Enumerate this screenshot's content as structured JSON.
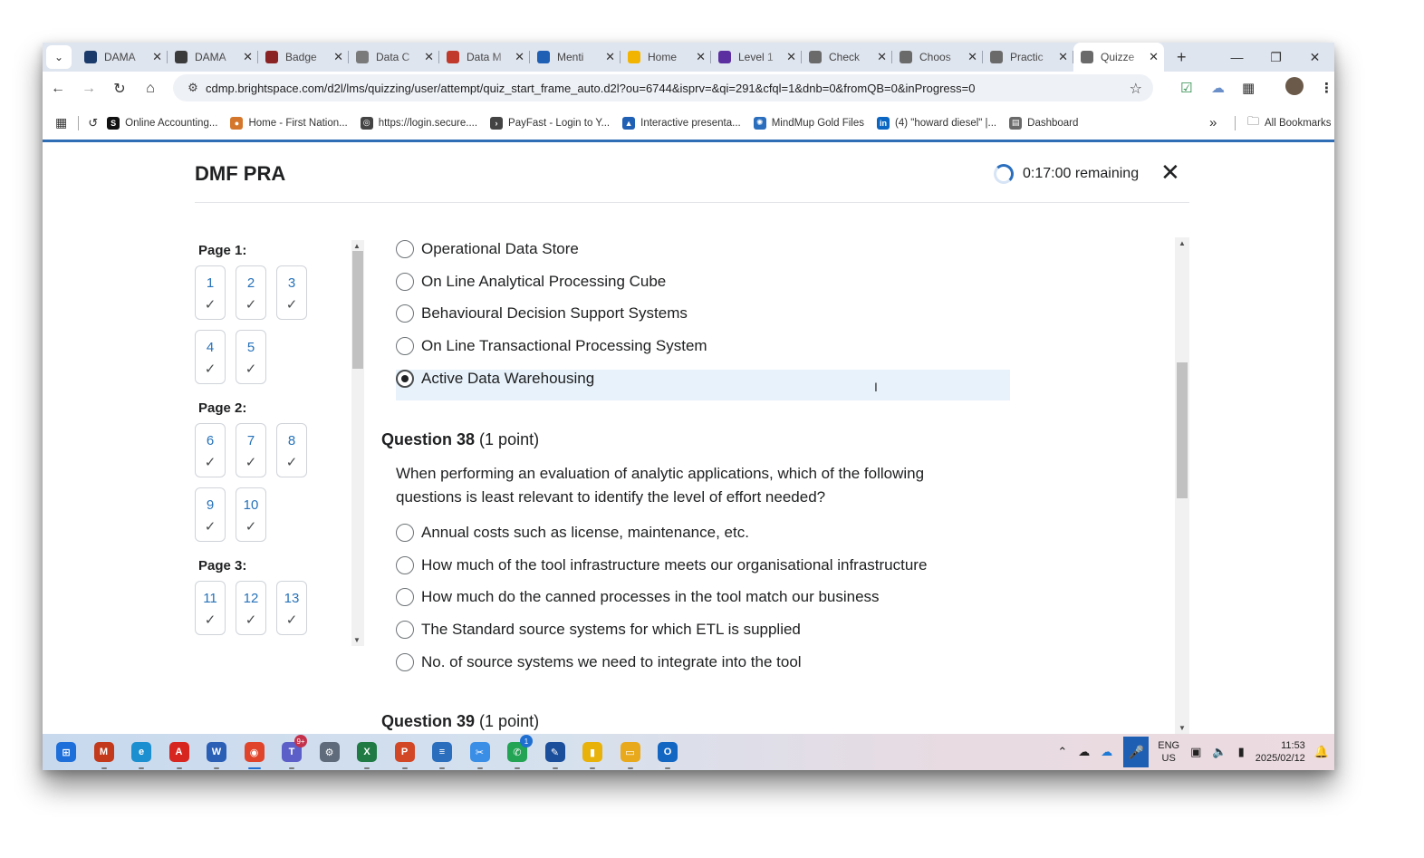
{
  "browser": {
    "tabs": [
      {
        "title": "DAMA",
        "icon": "dama-d-icon",
        "color": "#1a3a6b"
      },
      {
        "title": "DAMA",
        "icon": "globe-icon",
        "color": "#3b3b3b"
      },
      {
        "title": "Badge",
        "icon": "badge-icon",
        "color": "#8a2323"
      },
      {
        "title": "Data C",
        "icon": "loading-icon",
        "color": "#7a7a7a"
      },
      {
        "title": "Data M",
        "icon": "wheel-icon",
        "color": "#c0392b"
      },
      {
        "title": "Menti",
        "icon": "menti-icon",
        "color": "#1f5fb4"
      },
      {
        "title": "Home",
        "icon": "drive-icon",
        "color": "#f2b400"
      },
      {
        "title": "Level 1",
        "icon": "forms-icon",
        "color": "#5b2fa0"
      },
      {
        "title": "Check",
        "icon": "dama-icon",
        "color": "#6a6a6a"
      },
      {
        "title": "Choos",
        "icon": "dama-icon",
        "color": "#6a6a6a"
      },
      {
        "title": "Practic",
        "icon": "dama-icon",
        "color": "#6a6a6a"
      },
      {
        "title": "Quizze",
        "icon": "dama-icon",
        "color": "#6a6a6a",
        "active": true
      }
    ],
    "new_tab": "+",
    "url": "cdmp.brightspace.com/d2l/lms/quizzing/user/attempt/quiz_start_frame_auto.d2l?ou=6744&isprv=&qi=291&cfql=1&dnb=0&fromQB=0&inProgress=0",
    "bookmarks": [
      {
        "label": "Online Accounting...",
        "color": "#111111",
        "glyph": "S"
      },
      {
        "label": "Home - First Nation...",
        "color": "#d4772c",
        "glyph": "●"
      },
      {
        "label": "https://login.secure....",
        "color": "#444444",
        "glyph": "◎"
      },
      {
        "label": "PayFast - Login to Y...",
        "color": "#444444",
        "glyph": "›"
      },
      {
        "label": "Interactive presenta...",
        "color": "#1f5fb4",
        "glyph": "▲"
      },
      {
        "label": "MindMup Gold Files",
        "color": "#2a6ebd",
        "glyph": "✺"
      },
      {
        "label": "(4) \"howard diesel\" |...",
        "color": "#0a66c2",
        "glyph": "in"
      },
      {
        "label": "Dashboard",
        "color": "#6a6a6a",
        "glyph": "▤"
      }
    ],
    "more_bookmarks": "»",
    "all_bookmarks": "All Bookmarks"
  },
  "quiz": {
    "title": "DMF PRA",
    "timer": "0:17:00 remaining",
    "close": "✕",
    "pages": [
      {
        "label": "Page 1:",
        "questions": [
          "1",
          "2",
          "3",
          "4",
          "5"
        ]
      },
      {
        "label": "Page 2:",
        "questions": [
          "6",
          "7",
          "8",
          "9",
          "10"
        ]
      },
      {
        "label": "Page 3:",
        "questions": [
          "11",
          "12",
          "13"
        ]
      }
    ],
    "check_glyph": "✓",
    "prev_options": [
      {
        "text": "Operational Data Store",
        "selected": false
      },
      {
        "text": "On Line Analytical Processing Cube",
        "selected": false
      },
      {
        "text": "Behavioural Decision Support Systems",
        "selected": false
      },
      {
        "text": "On Line Transactional Processing System",
        "selected": false
      },
      {
        "text": "Active Data Warehousing",
        "selected": true
      }
    ],
    "q38": {
      "label": "Question 38",
      "points": "(1 point)",
      "text": "When performing an evaluation of analytic applications, which of the following questions is least relevant to identify the level of effort needed?",
      "options": [
        "Annual costs such as license, maintenance, etc.",
        "How much of the tool infrastructure meets our organisational infrastructure",
        "How much do the canned processes in the tool match our business",
        "The Standard source systems for which ETL is supplied",
        "No. of source systems we need to integrate into the tool"
      ]
    },
    "q39": {
      "label": "Question 39",
      "points": "(1 point)"
    }
  },
  "taskbar": {
    "apps": [
      {
        "name": "start",
        "color": "#1e6fd9",
        "glyph": "⊞"
      },
      {
        "name": "m365",
        "color": "#c2391b",
        "glyph": "M"
      },
      {
        "name": "edge",
        "color": "#1c8fd0",
        "glyph": "e"
      },
      {
        "name": "acrobat",
        "color": "#d7261f",
        "glyph": "A"
      },
      {
        "name": "word",
        "color": "#2b5fb5",
        "glyph": "W"
      },
      {
        "name": "chrome",
        "color": "#e0452b",
        "glyph": "◉",
        "active": true
      },
      {
        "name": "teams",
        "color": "#5b5fc7",
        "glyph": "T",
        "badge": "9+"
      },
      {
        "name": "settings",
        "color": "#5f6b7a",
        "glyph": "⚙"
      },
      {
        "name": "excel",
        "color": "#1f7a43",
        "glyph": "X"
      },
      {
        "name": "powerpoint",
        "color": "#d24726",
        "glyph": "P"
      },
      {
        "name": "notepad",
        "color": "#2a6ebd",
        "glyph": "≡"
      },
      {
        "name": "snipping",
        "color": "#3a8ee6",
        "glyph": "✂"
      },
      {
        "name": "whatsapp",
        "color": "#23a455",
        "glyph": "✆",
        "badge": "1"
      },
      {
        "name": "whiteboard",
        "color": "#1b4f9c",
        "glyph": "✎"
      },
      {
        "name": "powerbi",
        "color": "#e8b20b",
        "glyph": "▮"
      },
      {
        "name": "explorer",
        "color": "#e9a91c",
        "glyph": "▭"
      },
      {
        "name": "outlook",
        "color": "#1366c2",
        "glyph": "O"
      }
    ],
    "lang_top": "ENG",
    "lang_bottom": "US",
    "time": "11:53",
    "date": "2025/02/12"
  }
}
